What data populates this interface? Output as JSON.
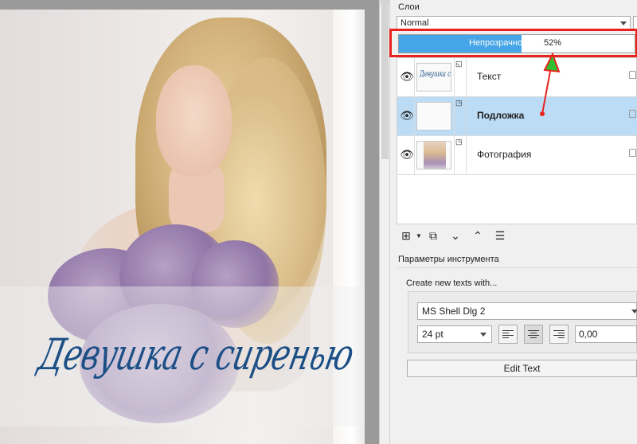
{
  "canvas": {
    "overlay_text": "Девушка с сиренью"
  },
  "layers_panel": {
    "title": "Слои",
    "blend_mode": "Normal",
    "opacity_label": "Непрозрачность:",
    "opacity_value": "52%",
    "opacity_fraction": 0.52,
    "layers": [
      {
        "name": "Текст",
        "thumb": "text-thumbnail",
        "selected": false,
        "thumb_text": "Девушка с сиренью"
      },
      {
        "name": "Подложка",
        "thumb": "blank-thumbnail",
        "selected": true
      },
      {
        "name": "Фотография",
        "thumb": "photo-thumbnail",
        "selected": false
      }
    ]
  },
  "tool_options": {
    "title": "Параметры инструмента",
    "create_label": "Create new texts with...",
    "font": "MS Shell Dlg 2",
    "size": "24 pt",
    "letter_spacing": "0,00",
    "edit_button": "Edit Text"
  },
  "colors": {
    "accent": "#45a5e6",
    "selection": "#bcdcf5",
    "annotation_red": "#e8221c",
    "annotation_green": "#2fbf2f",
    "title_blue": "#1c4f86"
  }
}
